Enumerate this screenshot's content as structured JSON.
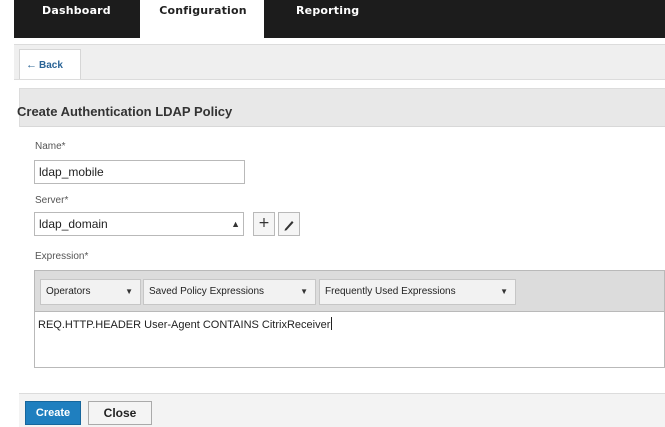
{
  "nav": {
    "tabs": [
      {
        "label": "Dashboard"
      },
      {
        "label": "Configuration"
      },
      {
        "label": "Reporting"
      }
    ]
  },
  "back": {
    "label": "Back",
    "icon": "arrow-left-icon"
  },
  "form": {
    "title": "Create Authentication LDAP Policy",
    "name": {
      "label": "Name*",
      "value": "ldap_mobile"
    },
    "server": {
      "label": "Server*",
      "value": "ldap_domain"
    },
    "expression": {
      "label": "Expression*",
      "dropdowns": [
        {
          "label": "Operators"
        },
        {
          "label": "Saved Policy Expressions"
        },
        {
          "label": "Frequently Used Expressions"
        }
      ],
      "value": "REQ.HTTP.HEADER User-Agent CONTAINS CitrixReceiver"
    }
  },
  "actions": {
    "create": "Create",
    "close": "Close"
  },
  "colors": {
    "topbar": "#1c1c1c",
    "primary_button": "#1f7fbf"
  }
}
